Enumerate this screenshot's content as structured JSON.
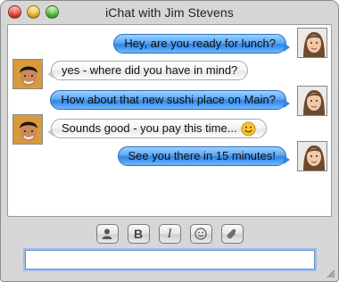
{
  "window": {
    "title": "iChat with Jim Stevens"
  },
  "messages": [
    {
      "sender": "me",
      "text": "Hey, are you ready for lunch?"
    },
    {
      "sender": "buddy",
      "text": "yes - where did you have in mind?"
    },
    {
      "sender": "me",
      "text": "How about that new sushi place on Main?"
    },
    {
      "sender": "buddy",
      "text": "Sounds good - you pay this time...",
      "emoticon": "smiley-icon"
    },
    {
      "sender": "me",
      "text": "See you there in 15 minutes!"
    }
  ],
  "toolbar": {
    "buttons": [
      "buddy-icon",
      "bold-icon",
      "italic-icon",
      "smiley-icon",
      "attachment-icon"
    ],
    "bold_label": "B",
    "italic_label": "I"
  },
  "input": {
    "value": "",
    "placeholder": ""
  },
  "colors": {
    "my_bubble": "#5aa8f2",
    "buddy_bubble": "#f3f3f3",
    "close": "#e0412f",
    "minimize": "#f0b62a",
    "zoom": "#4fb93a"
  }
}
